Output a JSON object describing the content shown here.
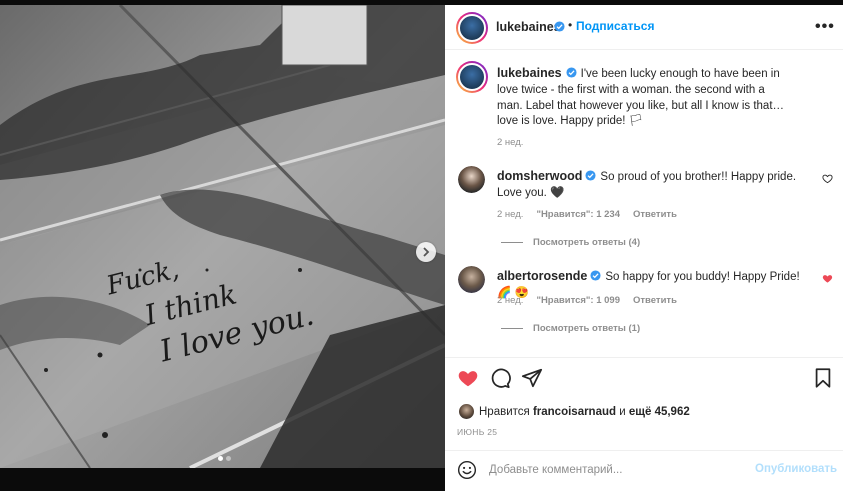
{
  "post": {
    "author": "lukebaines",
    "follow_label": "Подписаться",
    "bullet": "•",
    "more_label": "•••",
    "caption": "I've been lucky enough to have been in love twice - the first with a woman. the second with a man. Label that however you like, but all I know is that… love is love. Happy pride! 🏳",
    "caption_time": "2 нед.",
    "image_text": [
      "Fuck,",
      "I think",
      "I love you."
    ]
  },
  "comments": [
    {
      "user": "domsherwood",
      "text": "So proud of you brother!! Happy pride. Love you. 🖤",
      "time": "2 нед.",
      "likes": "\"Нравится\": 1 234",
      "reply_label": "Ответить",
      "view_replies": "Посмотреть ответы (4)",
      "liked": false
    },
    {
      "user": "albertorosende",
      "text": "So happy for you buddy! Happy Pride! 🌈 😍",
      "time": "2 нед.",
      "likes": "\"Нравится\": 1 099",
      "reply_label": "Ответить",
      "view_replies": "Посмотреть ответы (1)",
      "liked": true
    }
  ],
  "likes": {
    "prefix": "Нравится",
    "user": "francoisarnaud",
    "joiner": "и",
    "rest": "ещё 45,962"
  },
  "date_label": "Июнь 25",
  "add_comment": {
    "placeholder": "Добавьте комментарий...",
    "publish_label": "Опубликовать"
  },
  "icons": {
    "like": "heart-filled-icon",
    "comment": "comment-icon",
    "share": "send-icon",
    "save": "bookmark-icon",
    "emoji": "smiley-icon",
    "verified": "verified-badge-icon",
    "next": "chevron-right-icon"
  },
  "colors": {
    "link_blue": "#0095f6",
    "like_red": "#ed4956",
    "verified_blue": "#3897f0",
    "muted": "#8e8e8e",
    "publish_disabled": "#b2dffc"
  }
}
